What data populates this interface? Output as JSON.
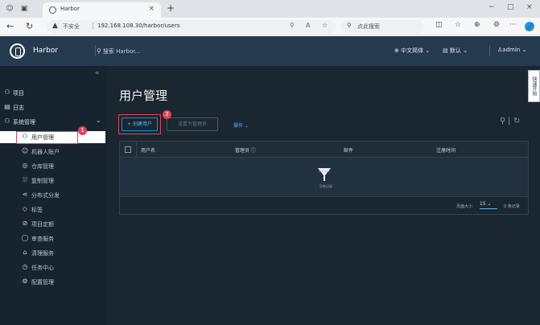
{
  "browser": {
    "tab_title": "Harbor",
    "security_label": "不安全",
    "url": "192.168.108.30/harbor/users",
    "search_placeholder": "点此搜索",
    "new_tab_symbol": "+",
    "close_symbol": "×",
    "minimize_symbol": "−",
    "maximize_symbol": "□",
    "more_symbol": "···"
  },
  "header": {
    "app_name": "Harbor",
    "search_placeholder": "搜索 Harbor...",
    "language": "中文简体",
    "theme": "默认",
    "user": "admin"
  },
  "sidebar": {
    "collapse_symbol": "«",
    "items": [
      {
        "label": "项目"
      },
      {
        "label": "日志"
      },
      {
        "label": "系统管理"
      }
    ],
    "admin_items": [
      {
        "label": "用户管理"
      },
      {
        "label": "机器人账户"
      },
      {
        "label": "仓库管理"
      },
      {
        "label": "复制管理"
      },
      {
        "label": "分布式分发"
      },
      {
        "label": "标签"
      },
      {
        "label": "项目定额"
      },
      {
        "label": "审查服务"
      },
      {
        "label": "清理服务"
      },
      {
        "label": "任务中心"
      },
      {
        "label": "配置管理"
      }
    ]
  },
  "main": {
    "title": "用户管理",
    "add_user_button": "+ 创建用户",
    "set_admin_button": "设置为管理员",
    "actions_label": "操作",
    "columns": [
      "用户名",
      "管理员",
      "邮件",
      "注册时间"
    ],
    "empty_text": "没有记录",
    "page_size_label": "页面大小",
    "page_size": "15",
    "record_count": "0 条记录"
  },
  "badges": {
    "first": "1",
    "second": "2"
  },
  "help_tab": "快速开始"
}
